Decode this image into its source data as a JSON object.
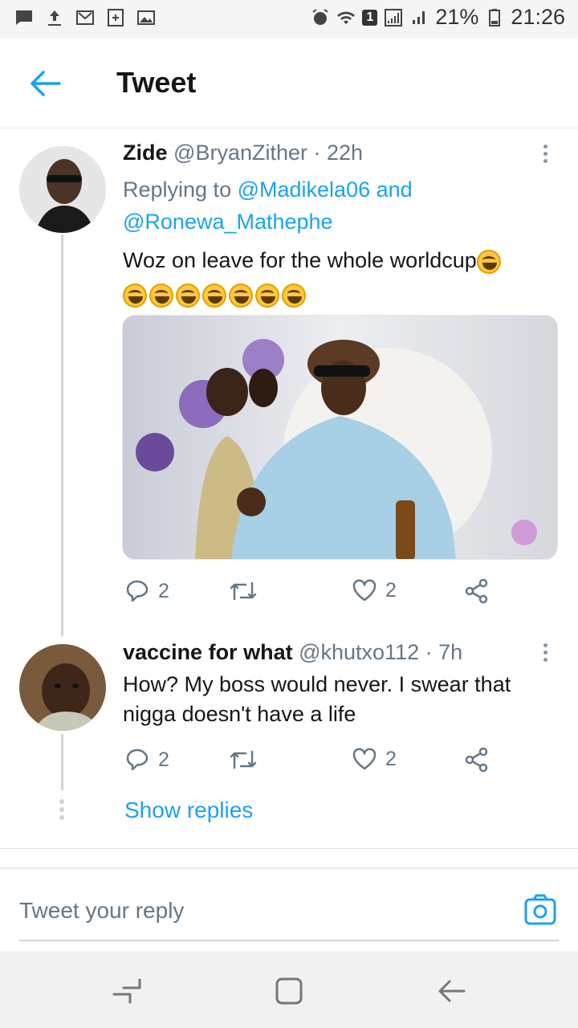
{
  "status_bar": {
    "battery_percent": "21%",
    "time": "21:26",
    "sim_badge": "1"
  },
  "header": {
    "title": "Tweet"
  },
  "tweet": {
    "name": "Zide",
    "handle": "@BryanZither",
    "time": "· 22h",
    "replying_prefix": "Replying to",
    "replying_to_1": "@Madikela06",
    "replying_and": "and",
    "replying_to_2": "@Ronewa_Mathephe",
    "text": "Woz on leave for the whole worldcup",
    "emoji_count": 8,
    "replies": "2",
    "likes": "2"
  },
  "reply": {
    "name": "vaccine for what",
    "handle": "@khutxo112",
    "time": "· 7h",
    "text_line1": "How? My boss would never. I swear that",
    "text_line2": "nigga doesn't have a life",
    "replies": "2",
    "likes": "2"
  },
  "show_replies_label": "Show replies",
  "compose": {
    "placeholder": "Tweet your reply"
  },
  "colors": {
    "accent": "#1da1f2",
    "secondary_text": "#657786"
  }
}
